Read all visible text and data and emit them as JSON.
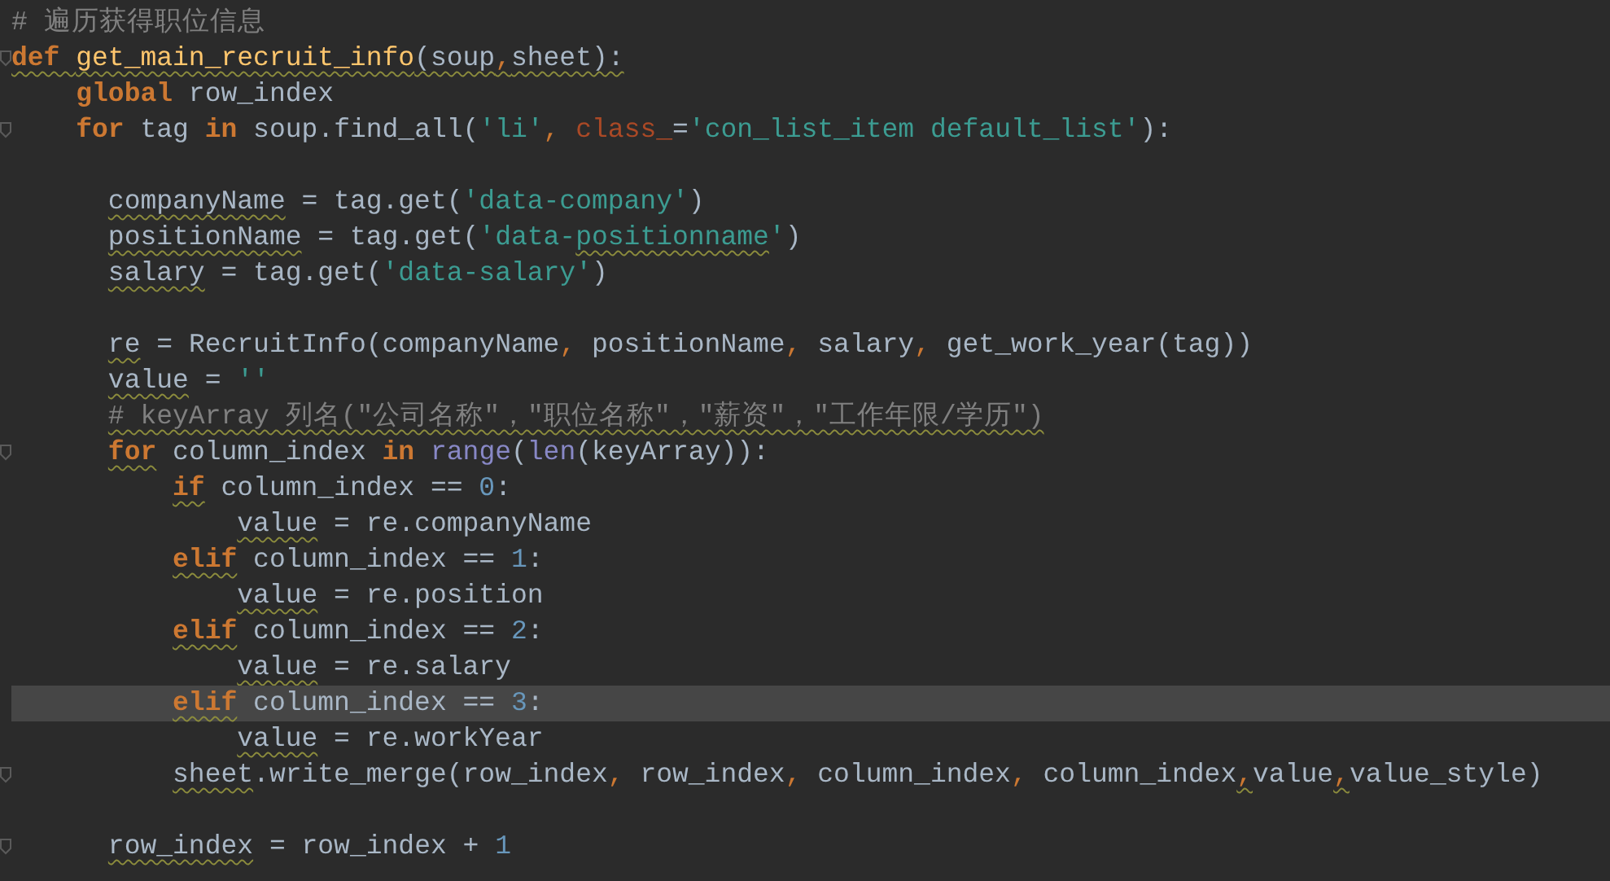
{
  "editor": {
    "lines": [
      {
        "fold": false,
        "current": false,
        "tokens": [
          {
            "text": "# 遍历获得职位信息",
            "kind": "comment"
          }
        ]
      },
      {
        "fold": true,
        "current": false,
        "tokens": [
          {
            "text": "def ",
            "kind": "keyword",
            "underlined": true
          },
          {
            "text": "get_main_recruit_info",
            "kind": "function",
            "underlined": true
          },
          {
            "text": "(soup",
            "kind": "plain",
            "underlined": true
          },
          {
            "text": ",",
            "kind": "punct",
            "underlined": true
          },
          {
            "text": "sheet):",
            "kind": "plain",
            "underlined": true
          }
        ]
      },
      {
        "fold": false,
        "current": false,
        "tokens": [
          {
            "text": "    global",
            "kind": "keyword"
          },
          {
            "text": " row_index",
            "kind": "plain"
          }
        ]
      },
      {
        "fold": true,
        "current": false,
        "tokens": [
          {
            "text": "    for",
            "kind": "keyword"
          },
          {
            "text": " tag ",
            "kind": "plain"
          },
          {
            "text": "in",
            "kind": "keyword"
          },
          {
            "text": " soup.find_all(",
            "kind": "plain"
          },
          {
            "text": "'li'",
            "kind": "string"
          },
          {
            "text": ", ",
            "kind": "punct"
          },
          {
            "text": "class_",
            "kind": "param"
          },
          {
            "text": "=",
            "kind": "plain"
          },
          {
            "text": "'con_list_item default_list'",
            "kind": "string"
          },
          {
            "text": "):",
            "kind": "plain"
          }
        ]
      },
      {
        "fold": false,
        "current": false
      },
      {
        "fold": false,
        "current": false,
        "tokens": [
          {
            "text": "      companyName",
            "kind": "plain",
            "underlined": true
          },
          {
            "text": " = tag.get(",
            "kind": "plain"
          },
          {
            "text": "'data-company'",
            "kind": "string"
          },
          {
            "text": ")",
            "kind": "plain"
          }
        ]
      },
      {
        "fold": false,
        "current": false,
        "tokens": [
          {
            "text": "      positionName",
            "kind": "plain",
            "underlined": true
          },
          {
            "text": " = tag.get(",
            "kind": "plain"
          },
          {
            "text": "'data-",
            "kind": "string"
          },
          {
            "text": "positionname",
            "kind": "string",
            "underlined": true
          },
          {
            "text": "'",
            "kind": "string"
          },
          {
            "text": ")",
            "kind": "plain"
          }
        ]
      },
      {
        "fold": false,
        "current": false,
        "tokens": [
          {
            "text": "      salary",
            "kind": "plain",
            "underlined": true
          },
          {
            "text": " = tag.get(",
            "kind": "plain"
          },
          {
            "text": "'data-salary'",
            "kind": "string"
          },
          {
            "text": ")",
            "kind": "plain"
          }
        ]
      },
      {
        "fold": false,
        "current": false
      },
      {
        "fold": false,
        "current": false,
        "tokens": [
          {
            "text": "      re",
            "kind": "plain",
            "underlined": true
          },
          {
            "text": " = RecruitInfo(companyName",
            "kind": "plain"
          },
          {
            "text": ", ",
            "kind": "punct"
          },
          {
            "text": "positionName",
            "kind": "plain"
          },
          {
            "text": ", ",
            "kind": "punct"
          },
          {
            "text": "salary",
            "kind": "plain"
          },
          {
            "text": ", ",
            "kind": "punct"
          },
          {
            "text": "get_work_year(tag))",
            "kind": "plain"
          }
        ]
      },
      {
        "fold": false,
        "current": false,
        "tokens": [
          {
            "text": "      value",
            "kind": "plain",
            "underlined": true
          },
          {
            "text": " = ",
            "kind": "plain"
          },
          {
            "text": "''",
            "kind": "string"
          }
        ]
      },
      {
        "fold": false,
        "current": false,
        "tokens": [
          {
            "text": "      # keyArray 列名(\"公司名称\"，\"职位名称\"，\"薪资\"，\"工作年限/学历\")",
            "kind": "comment",
            "underlined": true
          }
        ]
      },
      {
        "fold": true,
        "current": false,
        "tokens": [
          {
            "text": "      for",
            "kind": "keyword",
            "underlined": true
          },
          {
            "text": " column_index ",
            "kind": "plain"
          },
          {
            "text": "in ",
            "kind": "keyword"
          },
          {
            "text": "range",
            "kind": "builtin"
          },
          {
            "text": "(",
            "kind": "plain"
          },
          {
            "text": "len",
            "kind": "builtin"
          },
          {
            "text": "(keyArray)):",
            "kind": "plain"
          }
        ]
      },
      {
        "fold": false,
        "current": false,
        "tokens": [
          {
            "text": "          if",
            "kind": "keyword",
            "underlined": true
          },
          {
            "text": " column_index == ",
            "kind": "plain"
          },
          {
            "text": "0",
            "kind": "number"
          },
          {
            "text": ":",
            "kind": "plain"
          }
        ]
      },
      {
        "fold": false,
        "current": false,
        "tokens": [
          {
            "text": "              value",
            "kind": "plain",
            "underlined": true
          },
          {
            "text": " = re.companyName",
            "kind": "plain"
          }
        ]
      },
      {
        "fold": false,
        "current": false,
        "tokens": [
          {
            "text": "          elif",
            "kind": "keyword",
            "underlined": true
          },
          {
            "text": " column_index == ",
            "kind": "plain"
          },
          {
            "text": "1",
            "kind": "number"
          },
          {
            "text": ":",
            "kind": "plain"
          }
        ]
      },
      {
        "fold": false,
        "current": false,
        "tokens": [
          {
            "text": "              value",
            "kind": "plain",
            "underlined": true
          },
          {
            "text": " = re.position",
            "kind": "plain"
          }
        ]
      },
      {
        "fold": false,
        "current": false,
        "tokens": [
          {
            "text": "          elif",
            "kind": "keyword",
            "underlined": true
          },
          {
            "text": " column_index == ",
            "kind": "plain"
          },
          {
            "text": "2",
            "kind": "number"
          },
          {
            "text": ":",
            "kind": "plain"
          }
        ]
      },
      {
        "fold": false,
        "current": false,
        "tokens": [
          {
            "text": "              value",
            "kind": "plain",
            "underlined": true
          },
          {
            "text": " = re.salary",
            "kind": "plain"
          }
        ]
      },
      {
        "fold": false,
        "current": true,
        "tokens": [
          {
            "text": "          elif",
            "kind": "keyword",
            "underlined": true
          },
          {
            "text": " column_index == ",
            "kind": "plain"
          },
          {
            "text": "3",
            "kind": "number"
          },
          {
            "text": ":",
            "kind": "plain"
          }
        ]
      },
      {
        "fold": false,
        "current": false,
        "tokens": [
          {
            "text": "              value",
            "kind": "plain",
            "underlined": true
          },
          {
            "text": " = re.workYear",
            "kind": "plain"
          }
        ]
      },
      {
        "fold": true,
        "current": false,
        "tokens": [
          {
            "text": "          sheet",
            "kind": "plain",
            "underlined": true
          },
          {
            "text": ".write_merge(row_index",
            "kind": "plain"
          },
          {
            "text": ", ",
            "kind": "punct"
          },
          {
            "text": "row_index",
            "kind": "plain"
          },
          {
            "text": ", ",
            "kind": "punct"
          },
          {
            "text": "column_index",
            "kind": "plain"
          },
          {
            "text": ", ",
            "kind": "punct"
          },
          {
            "text": "column_index",
            "kind": "plain"
          },
          {
            "text": ",",
            "kind": "punct",
            "underlined": true
          },
          {
            "text": "value",
            "kind": "plain"
          },
          {
            "text": ",",
            "kind": "punct",
            "underlined": true
          },
          {
            "text": "value_style)",
            "kind": "plain"
          }
        ]
      },
      {
        "fold": false,
        "current": false
      },
      {
        "fold": true,
        "current": false,
        "tokens": [
          {
            "text": "      row_index",
            "kind": "plain",
            "underlined": true
          },
          {
            "text": " = row_index + ",
            "kind": "plain"
          },
          {
            "text": "1",
            "kind": "number"
          }
        ]
      }
    ]
  }
}
